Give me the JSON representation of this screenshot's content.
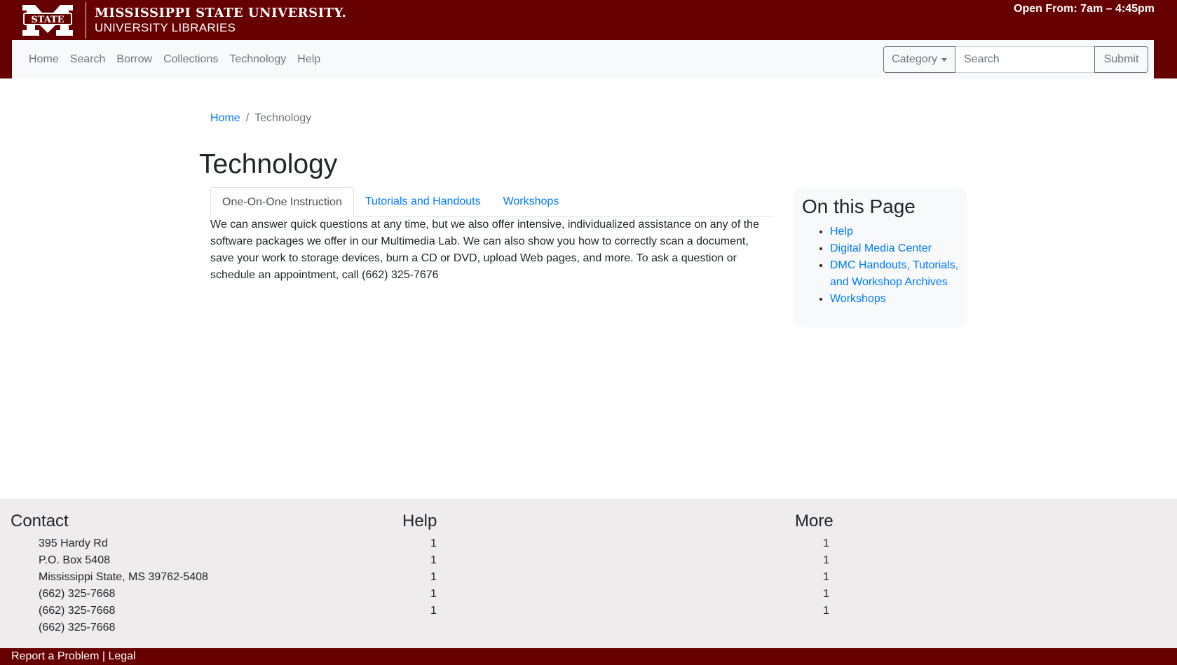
{
  "header": {
    "university": "MISSISSIPPI STATE UNIVERSITY.",
    "libraries": "UNIVERSITY LIBRARIES",
    "logo_word": "STATE",
    "hours": "Open From: 7am – 4:45pm"
  },
  "nav": {
    "items": [
      {
        "label": "Home"
      },
      {
        "label": "Search"
      },
      {
        "label": "Borrow"
      },
      {
        "label": "Collections"
      },
      {
        "label": "Technology"
      },
      {
        "label": "Help"
      }
    ],
    "category_label": "Category",
    "search_placeholder": "Search",
    "submit_label": "Submit"
  },
  "breadcrumb": {
    "home": "Home",
    "separator": "/",
    "current": "Technology"
  },
  "page": {
    "title": "Technology",
    "tabs": [
      {
        "label": "One-On-One Instruction",
        "active": true
      },
      {
        "label": "Tutorials and Handouts",
        "active": false
      },
      {
        "label": "Workshops",
        "active": false
      }
    ],
    "tab_content": "We can answer quick questions at any time, but we also offer intensive, individualized assistance on any of the software packages we offer in our Multimedia Lab. We can also show you how to correctly scan a document, save your work to storage devices, burn a CD or DVD, upload Web pages, and more. To ask a question or schedule an appointment, call (662) 325-7676"
  },
  "toc": {
    "title": "On this Page",
    "items": [
      {
        "label": "Help"
      },
      {
        "label": "Digital Media Center"
      },
      {
        "label": "DMC Handouts, Tutorials, and Workshop Archives"
      },
      {
        "label": "Workshops"
      }
    ]
  },
  "footer": {
    "contact": {
      "title": "Contact",
      "lines": [
        "395 Hardy Rd",
        "P.O. Box 5408",
        "Mississippi State, MS 39762-5408",
        "(662) 325-7668",
        "(662) 325-7668",
        "(662) 325-7668"
      ]
    },
    "help": {
      "title": "Help",
      "lines": [
        "1",
        "1",
        "1",
        "1",
        "1"
      ]
    },
    "more": {
      "title": "More",
      "lines": [
        "1",
        "1",
        "1",
        "1",
        "1"
      ]
    },
    "bottom": {
      "report": "Report a Problem",
      "separator": "|",
      "legal": "Legal"
    }
  },
  "colors": {
    "maroon": "#660000",
    "link": "#007bff",
    "footer_bg": "#eeecec"
  }
}
